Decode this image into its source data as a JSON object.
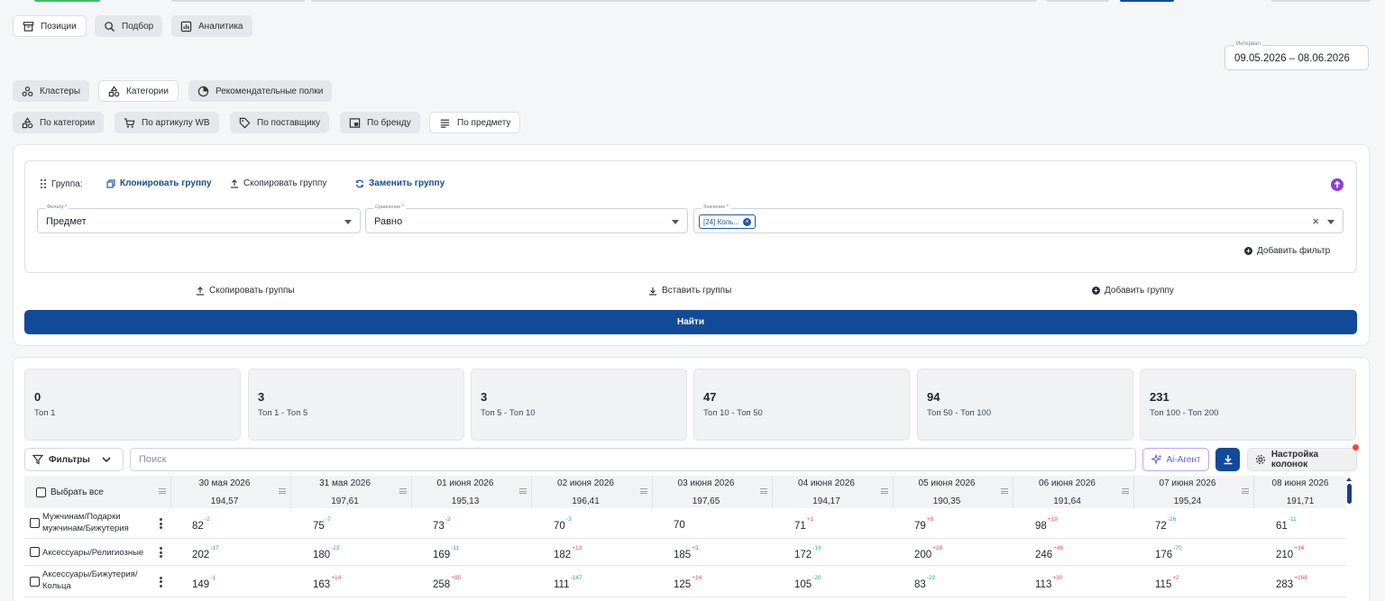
{
  "top_tabs": [
    {
      "label": "Позиции",
      "icon": "archive-icon",
      "active": true
    },
    {
      "label": "Подбор",
      "icon": "search-icon",
      "active": false
    },
    {
      "label": "Аналитика",
      "icon": "chart-icon",
      "active": false
    }
  ],
  "interval": {
    "label": "Интервал",
    "value": "09.05.2026 – 08.06.2026"
  },
  "mode_tabs": [
    {
      "label": "Кластеры",
      "icon": "clusters-icon",
      "active": false
    },
    {
      "label": "Категории",
      "icon": "categories-icon",
      "active": true
    },
    {
      "label": "Рекомендательные полки",
      "icon": "shelves-icon",
      "active": false
    }
  ],
  "sub_tabs": [
    {
      "label": "По категории",
      "icon": "categories-icon",
      "active": false
    },
    {
      "label": "По артикулу WB",
      "icon": "cart-icon",
      "active": false
    },
    {
      "label": "По поставщику",
      "icon": "tag-icon",
      "active": false
    },
    {
      "label": "По бренду",
      "icon": "brand-icon",
      "active": false
    },
    {
      "label": "По предмету",
      "icon": "list-icon",
      "active": true
    }
  ],
  "group": {
    "label": "Группа:",
    "clone": "Клонировать группу",
    "copy": "Скопировать группу",
    "replace": "Заменить группу",
    "filter": {
      "label": "Фильтр *",
      "value": "Предмет"
    },
    "compare": {
      "label": "Сравнение *",
      "value": "Равно"
    },
    "values": {
      "label": "Значение *",
      "tag": "[24] Коль..."
    },
    "add_filter": "Добавить фильтр"
  },
  "groups_actions": {
    "copy": "Скопировать группы",
    "paste": "Вставить группы",
    "add": "Добавить группу"
  },
  "find_button": "Найти",
  "stats": [
    {
      "value": "0",
      "label": "Топ 1"
    },
    {
      "value": "3",
      "label": "Топ 1 - Топ 5"
    },
    {
      "value": "3",
      "label": "Топ 5 - Топ 10"
    },
    {
      "value": "47",
      "label": "Топ 10 - Топ 50"
    },
    {
      "value": "94",
      "label": "Топ 50 - Топ 100"
    },
    {
      "value": "231",
      "label": "Топ 100 - Топ 200"
    }
  ],
  "toolbar": {
    "filters": "Фильтры",
    "search_placeholder": "Поиск",
    "ai": "Ai-Агент",
    "columns": "Настройка колонок"
  },
  "table": {
    "select_all": "Выбрать все",
    "columns": [
      {
        "date": "30 мая 2026",
        "sub": "194,57"
      },
      {
        "date": "31 мая 2026",
        "sub": "197,61"
      },
      {
        "date": "01 июня 2026",
        "sub": "195,13"
      },
      {
        "date": "02 июня 2026",
        "sub": "196,41"
      },
      {
        "date": "03 июня 2026",
        "sub": "197,65"
      },
      {
        "date": "04 июня 2026",
        "sub": "194,17"
      },
      {
        "date": "05 июня 2026",
        "sub": "190,35"
      },
      {
        "date": "06 июня 2026",
        "sub": "191,64"
      },
      {
        "date": "07 июня 2026",
        "sub": "195,24"
      },
      {
        "date": "08 июня 2026",
        "sub": "191,71"
      }
    ],
    "rows": [
      {
        "name": "Мужчинам/Подарки мужчинам/Бижутерия",
        "cells": [
          [
            "82",
            "-2"
          ],
          [
            "75",
            "-7"
          ],
          [
            "73",
            "-2"
          ],
          [
            "70",
            "-3"
          ],
          [
            "70",
            ""
          ],
          [
            "71",
            "+1"
          ],
          [
            "79",
            "+8"
          ],
          [
            "98",
            "+19"
          ],
          [
            "72",
            "-26"
          ],
          [
            "61",
            "-11"
          ]
        ]
      },
      {
        "name": "Аксессуары/Религиозные",
        "cells": [
          [
            "202",
            "-17"
          ],
          [
            "180",
            "-22"
          ],
          [
            "169",
            "-11"
          ],
          [
            "182",
            "+13"
          ],
          [
            "185",
            "+3"
          ],
          [
            "172",
            "-13"
          ],
          [
            "200",
            "+28"
          ],
          [
            "246",
            "+46"
          ],
          [
            "176",
            "-70"
          ],
          [
            "210",
            "+34"
          ]
        ]
      },
      {
        "name": "Аксессуары/Бижутерия/Кольца",
        "cells": [
          [
            "149",
            "-1"
          ],
          [
            "163",
            "+14"
          ],
          [
            "258",
            "+95"
          ],
          [
            "111",
            "-147"
          ],
          [
            "125",
            "+14"
          ],
          [
            "105",
            "-20"
          ],
          [
            "83",
            "-22"
          ],
          [
            "113",
            "+30"
          ],
          [
            "115",
            "+2"
          ],
          [
            "283",
            "+168"
          ]
        ]
      }
    ]
  },
  "colors": {
    "primary": "#124a9a",
    "up": "#e24c4c",
    "down": "#2bab8f",
    "ai": "#6b5bd2"
  }
}
